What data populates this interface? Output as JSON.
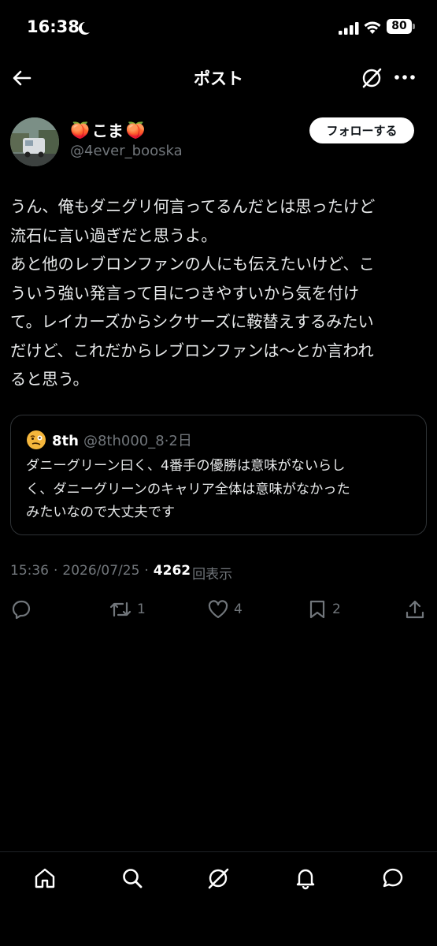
{
  "status": {
    "time": "16:38",
    "battery": "80"
  },
  "header": {
    "title": "ポスト"
  },
  "author": {
    "emoji_left": "🍑",
    "name": "こま",
    "emoji_right": "🍑",
    "handle": "@4ever_booska",
    "follow_label": "フォローする"
  },
  "post": {
    "text": "うん、俺もダニグリ何言ってるんだとは思ったけど\n流石に言い過ぎだと思うよ。\nあと他のレブロンファンの人にも伝えたいけど、こ\nういう強い発言って目につきやすいから気を付け\nて。レイカーズからシクサーズに鞍替えするみたい\nだけど、これだからレブロンファンは〜とか言われ\nると思う。"
  },
  "quote": {
    "name": "8th",
    "handle": "@8th000_8",
    "separator": "·",
    "time": "2日",
    "text": "ダニーグリーン曰く、4番手の優勝は意味がないらし\nく、ダニーグリーンのキャリア全体は意味がなかった\nみたいなので大丈夫です"
  },
  "meta": {
    "time": "15:36",
    "separator": "·",
    "date": "2026/07/25",
    "views": "4262",
    "views_label": "回表示"
  },
  "actions": {
    "reply_count": "",
    "repost_count": "1",
    "like_count": "4",
    "bookmark_count": "2"
  },
  "icons": [
    "back-arrow-icon",
    "grok-icon",
    "more-icon",
    "reply-icon",
    "repost-icon",
    "like-icon",
    "bookmark-icon",
    "share-icon",
    "home-icon",
    "search-icon",
    "notifications-icon",
    "messages-icon"
  ],
  "colors": {
    "background": "#000000",
    "text": "#e7e9ea",
    "muted": "#71767b",
    "border": "#2f3336"
  }
}
